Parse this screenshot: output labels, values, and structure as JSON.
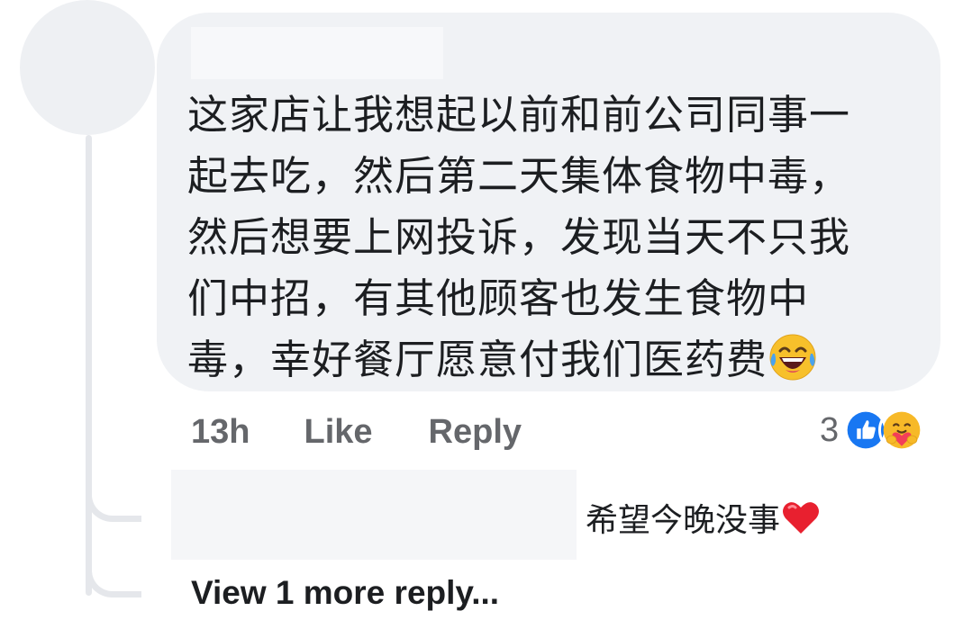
{
  "comment": {
    "lines": [
      "这家店让我想起以前和前公司同事一",
      "起去吃，然后第二天集体食物中毒，",
      "然后想要上网投诉，发现当天不只我",
      "们中招，有其他顾客也发生食物中",
      "毒，幸好餐厅愿意付我们医药费"
    ],
    "trailing_emoji": "face-with-tears-of-joy-icon"
  },
  "actions": {
    "time": "13h",
    "like_label": "Like",
    "reply_label": "Reply"
  },
  "reactions": {
    "count": "3",
    "icons": [
      "like-reaction-icon",
      "care-reaction-icon"
    ],
    "colors": {
      "like": "#1877f2",
      "care": "#f7b928"
    }
  },
  "reply": {
    "text": "希望今晚没事",
    "trailing_emoji": "red-heart-icon"
  },
  "view_more": {
    "label": "View 1 more reply..."
  },
  "colors": {
    "bubble": "#f0f2f5",
    "secondary_text": "#65676b",
    "primary_text": "#1c1e21",
    "thread_line": "#e5e7eb"
  }
}
